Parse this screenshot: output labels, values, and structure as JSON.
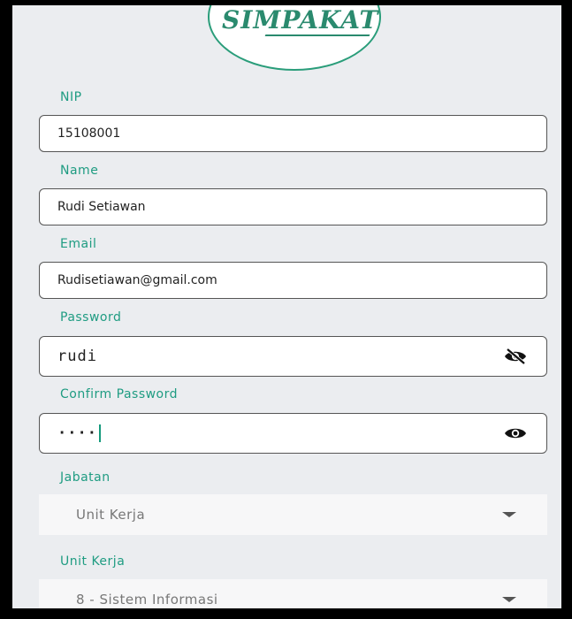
{
  "logo": {
    "text": "SIMPAKAT"
  },
  "form": {
    "nip": {
      "label": "NIP",
      "value": "15108001"
    },
    "name": {
      "label": "Name",
      "value": "Rudi Setiawan"
    },
    "email": {
      "label": "Email",
      "value": "Rudisetiawan@gmail.com"
    },
    "password": {
      "label": "Password",
      "value": "rudi",
      "icon": "eye-off-icon"
    },
    "confirm_password": {
      "label": "Confirm Password",
      "value": "····",
      "icon": "eye-icon"
    },
    "jabatan": {
      "label": "Jabatan",
      "selected": "Unit Kerja"
    },
    "unit_kerja": {
      "label": "Unit Kerja",
      "selected": "8 - Sistem Informasi"
    }
  },
  "colors": {
    "accent": "#1f9c82",
    "background": "#ebedf0",
    "field_border": "#555555"
  }
}
